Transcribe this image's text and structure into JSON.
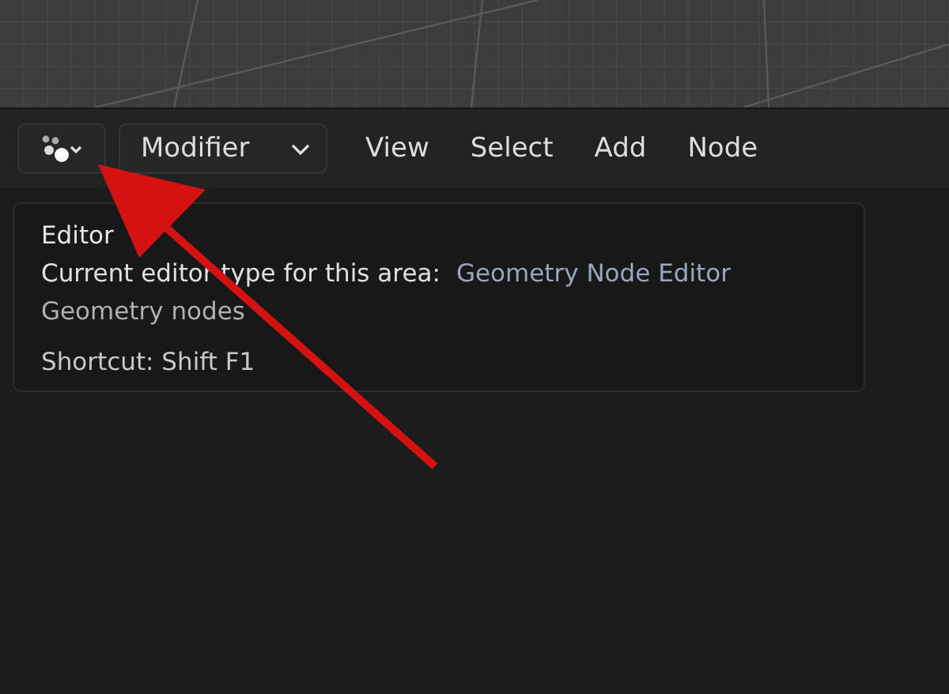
{
  "header": {
    "mode_dropdown": {
      "value": "Modifier"
    },
    "menus": [
      "View",
      "Select",
      "Add",
      "Node"
    ]
  },
  "tooltip": {
    "title": "Editor",
    "description": "Current editor type for this area:",
    "value": "Geometry Node Editor",
    "subtitle": "Geometry nodes",
    "shortcut": "Shortcut: Shift F1"
  }
}
